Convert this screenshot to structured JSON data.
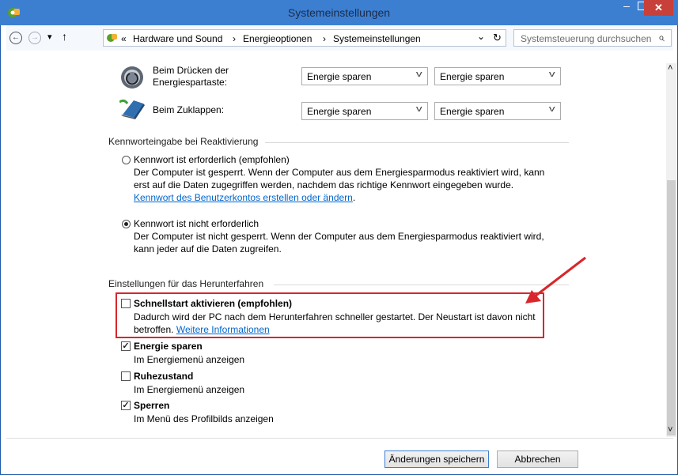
{
  "window": {
    "title": "Systemeinstellungen",
    "minimize_glyph": "–",
    "close_glyph": "✕"
  },
  "nav": {
    "back_glyph": "←",
    "forward_glyph": "→",
    "history_glyph": "▾",
    "up_glyph": "↑",
    "breadcrumb_prefix": "«",
    "breadcrumbs": [
      "Hardware und Sound",
      "Energieoptionen",
      "Systemeinstellungen"
    ],
    "crumb_separator": "›",
    "dropdown_glyph": "⌄",
    "refresh_glyph": "↻",
    "search_placeholder": "Systemsteuerung durchsuchen",
    "search_glyph": "⌕"
  },
  "power_buttons": {
    "rows": [
      {
        "label_line1": "Beim Drücken der",
        "label_line2": "Energiespartaste:",
        "icon": "power-button-icon",
        "battery_value": "Energie sparen",
        "plugged_value": "Energie sparen"
      },
      {
        "label_line1": "Beim Zuklappen:",
        "label_line2": "",
        "icon": "laptop-lid-icon",
        "battery_value": "Energie sparen",
        "plugged_value": "Energie sparen"
      }
    ]
  },
  "password": {
    "group_title": "Kennworteingabe bei Reaktivierung",
    "option1_label": "Kennwort ist erforderlich (empfohlen)",
    "option1_desc1": "Der Computer ist gesperrt. Wenn der Computer aus dem Energiesparmodus reaktiviert wird, kann",
    "option1_desc2": "erst auf die Daten zugegriffen werden, nachdem das richtige Kennwort eingegeben wurde.",
    "option1_link": "Kennwort des Benutzerkontos erstellen oder ändern",
    "option1_link_suffix": ".",
    "option2_label": "Kennwort ist nicht erforderlich",
    "option2_desc1": "Der Computer ist nicht gesperrt. Wenn der Computer aus dem Energiesparmodus reaktiviert wird,",
    "option2_desc2": "kann jeder auf die Daten zugreifen.",
    "selected": "option2"
  },
  "shutdown": {
    "group_title": "Einstellungen für das Herunterfahren",
    "fast_startup_label": "Schnellstart aktivieren (empfohlen)",
    "fast_startup_desc1": "Dadurch wird der PC nach dem Herunterfahren schneller gestartet. Der Neustart ist davon nicht",
    "fast_startup_desc2": "betroffen.",
    "fast_startup_link": "Weitere Informationen",
    "fast_startup_checked": false,
    "sleep_label": "Energie sparen",
    "sleep_desc": "Im Energiemenü anzeigen",
    "sleep_checked": true,
    "hibernate_label": "Ruhezustand",
    "hibernate_desc": "Im Energiemenü anzeigen",
    "hibernate_checked": false,
    "lock_label": "Sperren",
    "lock_desc": "Im Menü des Profilbilds anzeigen",
    "lock_checked": true,
    "check_glyph": "✓"
  },
  "scroll": {
    "up_glyph": "˄",
    "down_glyph": "˅"
  },
  "footer": {
    "save_label": "Änderungen speichern",
    "cancel_label": "Abbrechen"
  },
  "annotation": {
    "highlight_color": "#d8262c"
  }
}
